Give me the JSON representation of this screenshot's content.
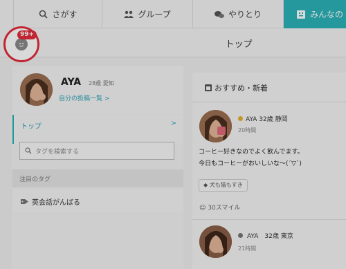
{
  "nav": {
    "tabs": [
      {
        "label": "さがす",
        "icon": "search-icon"
      },
      {
        "label": "グループ",
        "icon": "group-icon"
      },
      {
        "label": "やりとり",
        "icon": "chat-icon"
      },
      {
        "label": "みんなの",
        "icon": "board-icon"
      }
    ]
  },
  "header": {
    "title": "トップ",
    "badge": "99+"
  },
  "sidebar": {
    "profile": {
      "name": "AYA",
      "meta": "28歳 愛知",
      "link": "自分の投稿一覧 >"
    },
    "top_item": {
      "label": "トップ",
      "chevron": ">"
    },
    "search": {
      "placeholder": "タグを検索する"
    },
    "tags_heading": "注目のタグ",
    "tag": "英会話がんばる"
  },
  "feed": {
    "heading": "おすすめ・新着",
    "posts": [
      {
        "name": "AYA 32歳 静岡",
        "time": "20時間",
        "line1": "コーヒー好きなのでよく飲んでます。",
        "line2": "今日もコーヒーがおいしいな〜(´▽`)",
        "tag": "犬も猫もすき",
        "smiles": "30スマイル",
        "status_color": "#e3b32e"
      },
      {
        "name": "AYA　32歳 東京",
        "time": "21時間",
        "status_color": "#777777"
      }
    ]
  },
  "colors": {
    "accent": "#2bb3b8",
    "badge": "#e22c3a"
  }
}
